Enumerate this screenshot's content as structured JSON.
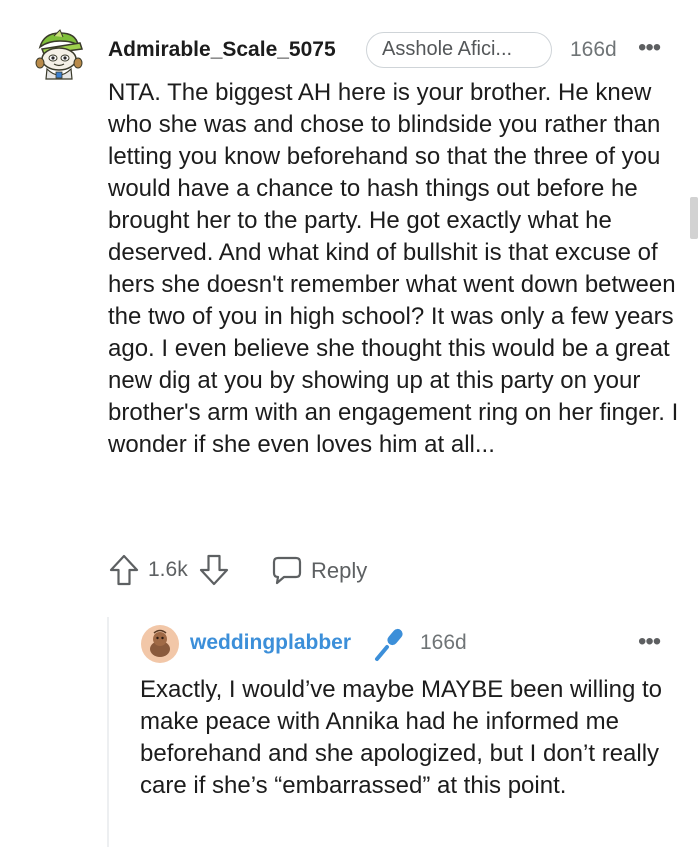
{
  "comment": {
    "username": "Admirable_Scale_5075",
    "flair": "Asshole Afici...",
    "time": "166d",
    "more_label": "•••",
    "body": "NTA. The biggest AH here is your brother. He knew who she was and chose to blindside you rather than letting you know beforehand so that the three of you would have a chance to hash things out before he brought her to the party. He got exactly what he deserved. And what kind of bullshit is that excuse of hers she doesn't remember what went down between the two of you in high school? It was only a few years ago. I even believe she thought this would be a great new dig at you by showing up at this party on your brother's arm with an engagement ring on her finger. I wonder if she even loves him at all...",
    "score": "1.6k",
    "reply_label": "Reply",
    "avatar_icon": "snoo-avatar-green-hat",
    "upvote_icon": "arrow-up-outline-icon",
    "downvote_icon": "arrow-down-outline-icon",
    "reply_icon": "speech-bubble-icon"
  },
  "reply": {
    "username": "weddingplabber",
    "time": "166d",
    "more_label": "•••",
    "badge_icon": "microphone-icon",
    "avatar_icon": "snoo-avatar-peach",
    "body": "Exactly, I would’ve maybe MAYBE been willing to make peace with Annika had he informed me beforehand and she apologized, but I don’t really care if she’s “embarrassed” at this point."
  },
  "colors": {
    "text": "#1c1c1c",
    "meta": "#6f7476",
    "username_link": "#3c8fd9",
    "flair_border": "#cfd4d8",
    "thread_line": "#edeff1"
  }
}
